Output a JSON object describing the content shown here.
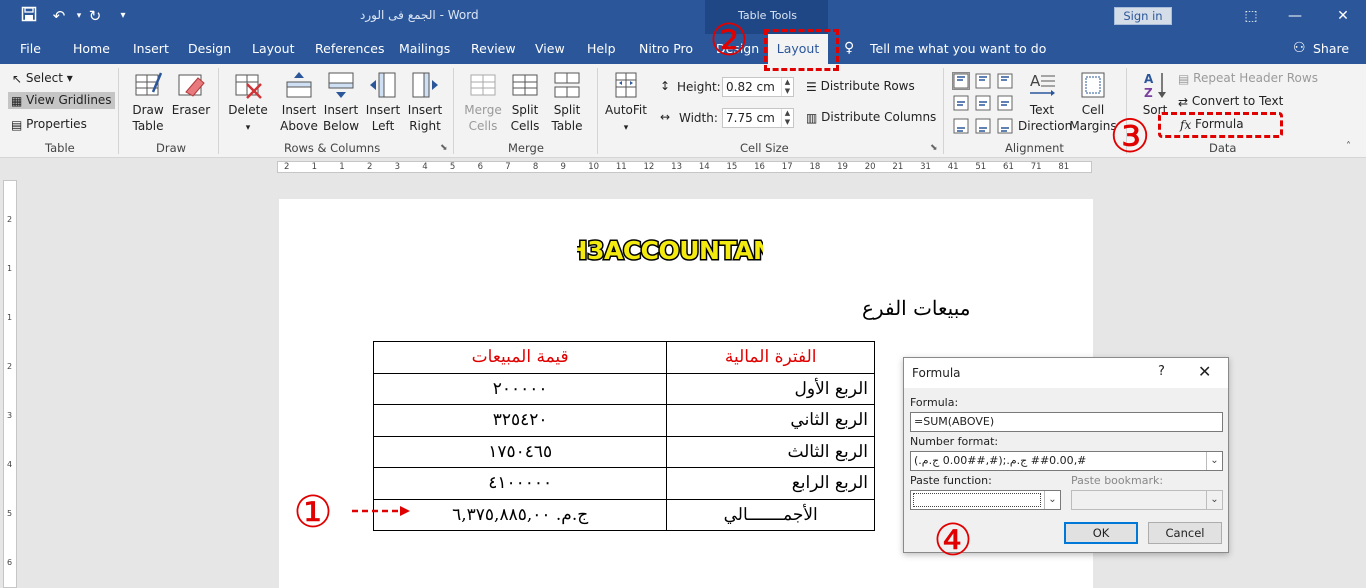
{
  "titlebar": {
    "title": "الجمع فى الورد  -  Word",
    "context_label": "Table Tools",
    "signin_label": "Sign in"
  },
  "tabs": {
    "file": "File",
    "home": "Home",
    "insert": "Insert",
    "design": "Design",
    "layout": "Layout",
    "references": "References",
    "mailings": "Mailings",
    "review": "Review",
    "view": "View",
    "help": "Help",
    "nitro": "Nitro Pro",
    "table_design": "Design",
    "table_layout": "Layout",
    "tellme": "Tell me what you want to do",
    "share": "Share"
  },
  "ribbon": {
    "table": {
      "select": "Select ▾",
      "view_gridlines": "View Gridlines",
      "properties": "Properties",
      "label": "Table"
    },
    "draw": {
      "draw_table": "Draw Table",
      "eraser": "Eraser",
      "label": "Draw"
    },
    "rows_columns": {
      "delete": "Delete",
      "insert_above": "Insert Above",
      "insert_below": "Insert Below",
      "insert_left": "Insert Left",
      "insert_right": "Insert Right",
      "label": "Rows & Columns"
    },
    "merge": {
      "merge_cells": "Merge Cells",
      "split_cells": "Split Cells",
      "split_table": "Split Table",
      "label": "Merge"
    },
    "cell_size": {
      "autofit": "AutoFit",
      "height_label": "Height:",
      "height_value": "0.82 cm",
      "width_label": "Width:",
      "width_value": "7.75 cm",
      "distribute_rows": "Distribute Rows",
      "distribute_columns": "Distribute Columns",
      "label": "Cell Size"
    },
    "alignment": {
      "text_direction": "Text Direction",
      "cell_margins": "Cell Margins",
      "label": "Alignment"
    },
    "data": {
      "sort": "Sort",
      "repeat_header_rows": "Repeat Header Rows",
      "convert_to_text": "Convert to Text",
      "formula": "Formula",
      "label": "Data"
    }
  },
  "ruler": {
    "ticks": [
      "2",
      "1",
      "1",
      "2",
      "3",
      "4",
      "5",
      "6",
      "7",
      "8",
      "9",
      "10",
      "11",
      "12",
      "13",
      "14",
      "15",
      "16",
      "17",
      "18",
      "19",
      "20",
      "21",
      "31",
      "41",
      "51",
      "61",
      "71",
      "81"
    ],
    "vticks": [
      "2",
      "1",
      "1",
      "2",
      "3",
      "4",
      "5",
      "6"
    ]
  },
  "document": {
    "heading": "مبيعات الفرع",
    "table": {
      "headers": [
        "الفترة المالية",
        "قيمة المبيعات"
      ],
      "rows": [
        [
          "الربع الأول",
          "٢٠٠٠٠٠"
        ],
        [
          "الربع الثاني",
          "٣٢٥٤٢٠"
        ],
        [
          "الربع الثالث",
          "١٧٥٠٤٦٥"
        ],
        [
          "الربع الرابع",
          "٤١٠٠٠٠٠"
        ],
        [
          "الأجمـــــــالي",
          "ج.م.  ٦,٣٧٥,٨٨٥,٠٠"
        ]
      ]
    }
  },
  "dialog": {
    "title": "Formula",
    "help": "?",
    "close": "✕",
    "formula_label": "Formula:",
    "formula_value": "=SUM(ABOVE)",
    "number_format_label": "Number format:",
    "number_format_value": "#,##0.00 ج.م.;(#,##0.00 ج.م.)",
    "paste_function_label": "Paste function:",
    "paste_bookmark_label": "Paste bookmark:",
    "ok": "OK",
    "cancel": "Cancel"
  },
  "annotations": {
    "one": "①",
    "two": "②",
    "three": "③",
    "four": "④"
  },
  "colors": {
    "word_blue": "#2b579a",
    "annotation_red": "#e00000"
  }
}
